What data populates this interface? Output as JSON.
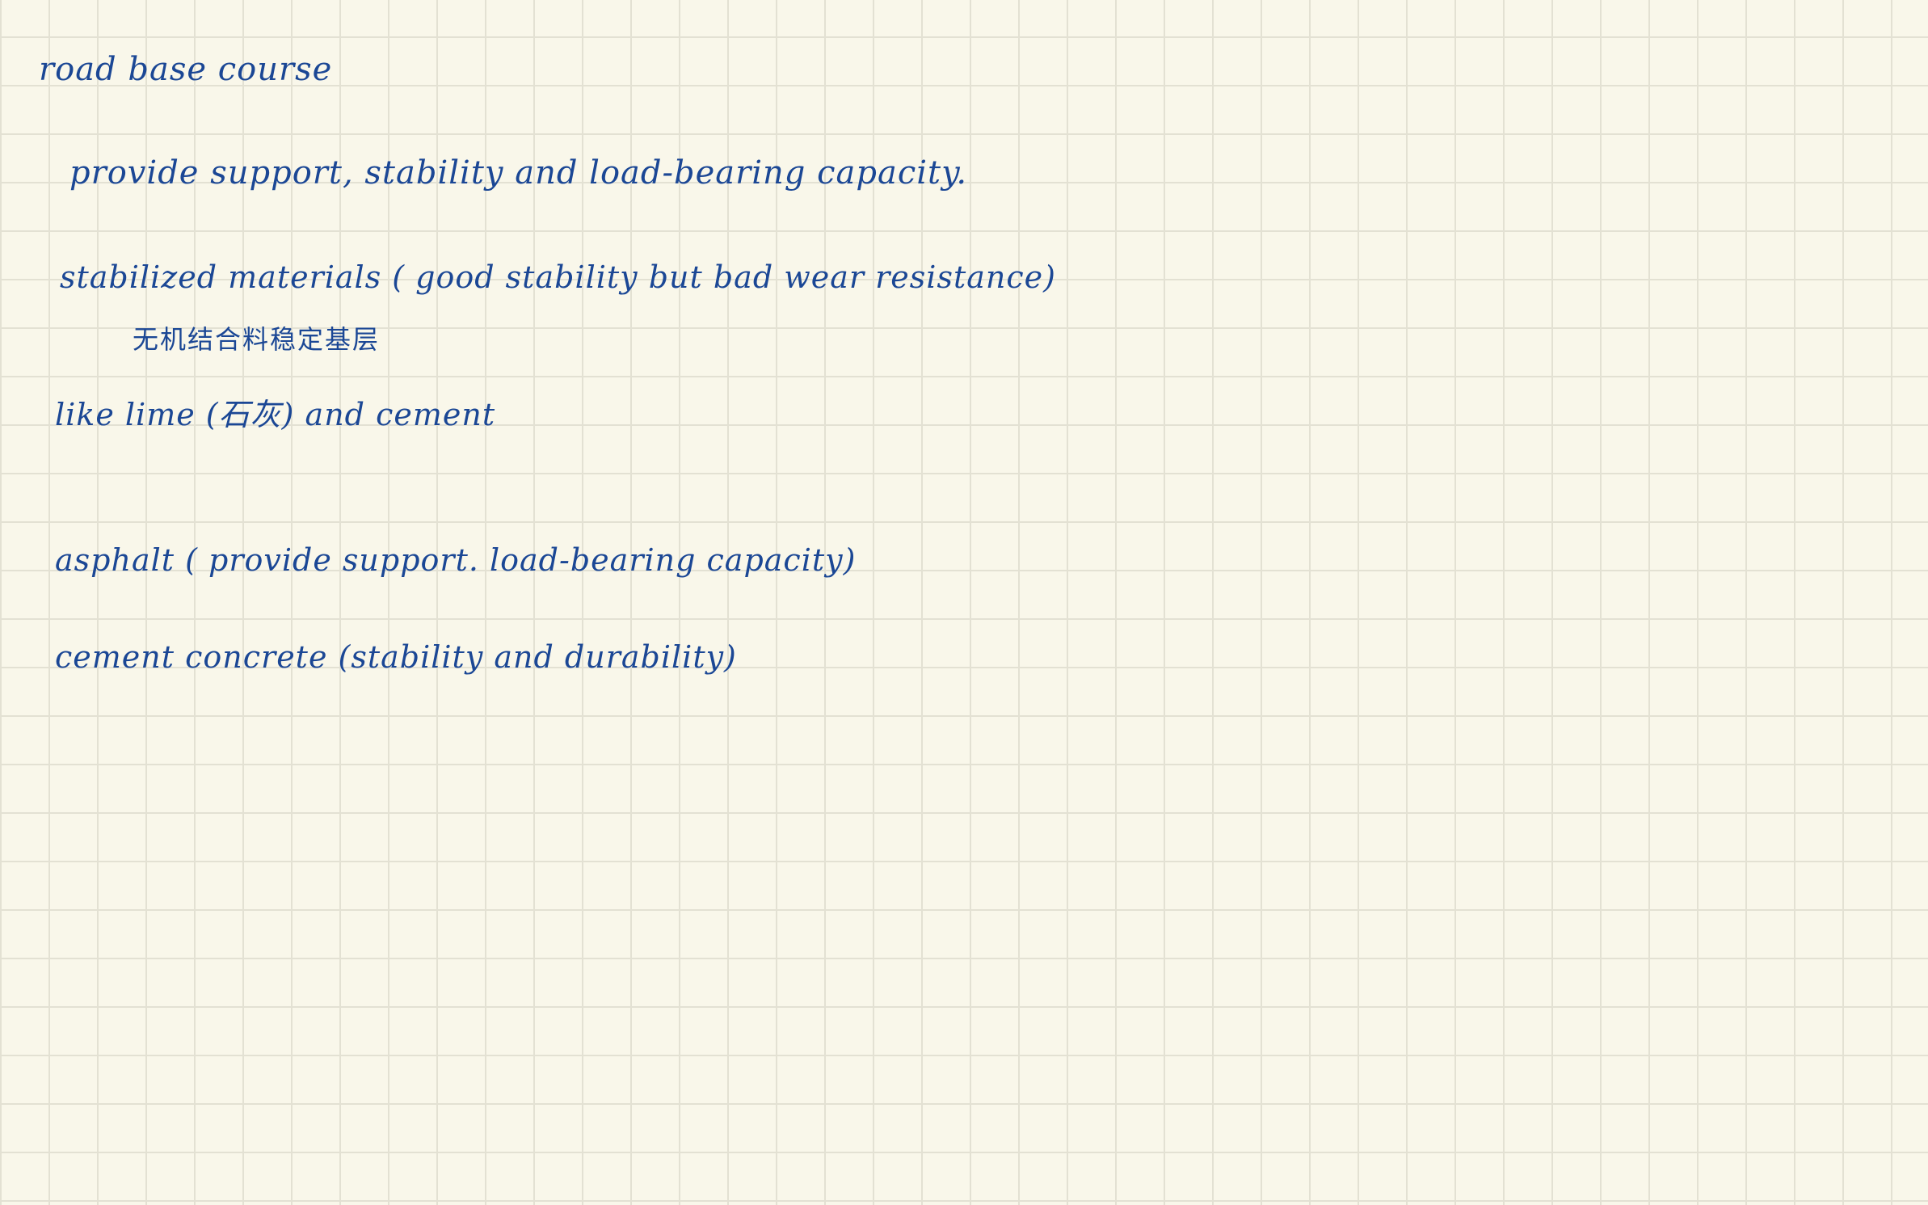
{
  "notes": {
    "title": "road base course",
    "lines": [
      "provide support, stability and load-bearing capacity.",
      "stabilized materials   ( good stability but bad wear resistance)",
      "无机结合料稳定基层",
      "like lime (石灰) and  cement",
      "asphalt   ( provide support. load-bearing capacity)",
      "cement  concrete  (stability and durability)"
    ]
  },
  "colors": {
    "paper": "#f9f7ea",
    "grid": "#e3e1d3",
    "ink": "#1b4795"
  }
}
